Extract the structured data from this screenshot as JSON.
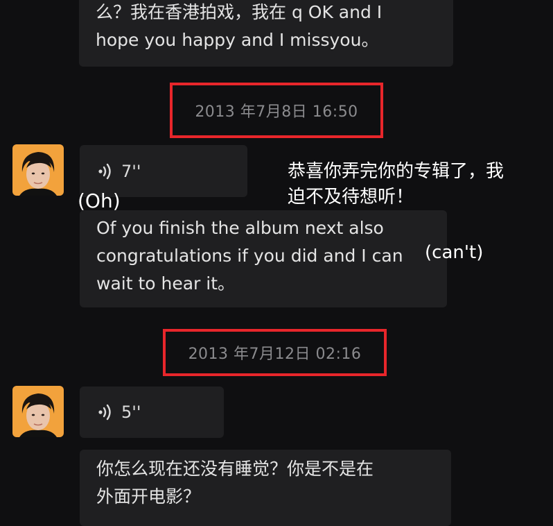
{
  "messages": {
    "top_transcript": {
      "lines": [
        "么？我在香港拍戏，我在 q OK and I",
        "hope you happy and I missyou。"
      ]
    },
    "timestamp_1": "2013 年7月8日 16:50",
    "voice_1": {
      "duration": "7''"
    },
    "transcript_1": {
      "lines": [
        "Of you finish the album next also",
        "congratulations if you did and I can",
        "wait to hear it。"
      ]
    },
    "timestamp_2": "2013 年7月12日 02:16",
    "voice_2": {
      "duration": "5''"
    },
    "transcript_2": {
      "lines": [
        "你怎么现在还没有睡觉？你是不是在",
        "外面开电影？"
      ]
    }
  },
  "annotations": {
    "translation_lines": [
      "恭喜你弄完你的专辑了，我",
      "迫不及待想听！"
    ],
    "oh_note": "(Oh)",
    "cant_note": "(can't)"
  },
  "colors": {
    "background": "#0f0f11",
    "bubble": "#1f1f21",
    "highlight_border": "#e8262b",
    "timestamp_text": "#8b8b8e",
    "avatar_bg": "#f2a23c"
  }
}
